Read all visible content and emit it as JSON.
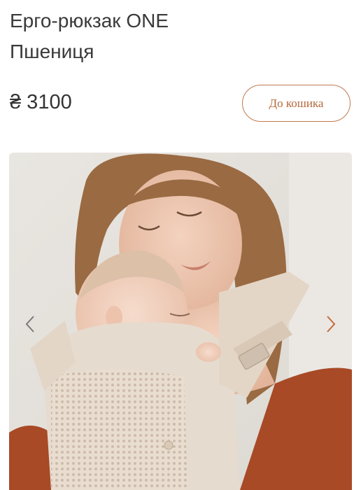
{
  "product": {
    "title_line1": "Ерго-рюкзак ONE",
    "title_line2": "Пшениця",
    "price": "₴ 3100",
    "add_to_cart_label": "До кошика"
  },
  "colors": {
    "accent": "#c07a4f",
    "accent_text": "#b5693b",
    "text": "#333333"
  },
  "gallery": {
    "image_alt_icon": "photo-of-mother-with-baby-in-carrier",
    "prev_icon": "chevron-left-icon",
    "next_icon": "chevron-right-icon"
  }
}
